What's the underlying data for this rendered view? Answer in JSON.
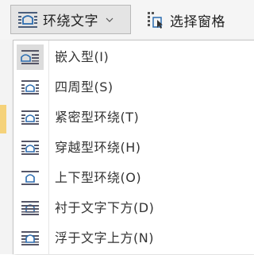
{
  "ribbon": {
    "wrap_button": {
      "label": "环绕文字",
      "icon": "wrap-text-icon"
    },
    "selection_pane": {
      "label": "选择窗格",
      "icon": "selection-pane-icon"
    }
  },
  "menu": {
    "items": [
      {
        "label": "嵌入型(I)",
        "icon": "inline-with-text-icon"
      },
      {
        "label": "四周型(S)",
        "icon": "square-wrap-icon"
      },
      {
        "label": "紧密型环绕(T)",
        "icon": "tight-wrap-icon"
      },
      {
        "label": "穿越型环绕(H)",
        "icon": "through-wrap-icon"
      },
      {
        "label": "上下型环绕(O)",
        "icon": "top-bottom-wrap-icon"
      },
      {
        "label": "衬于文字下方(D)",
        "icon": "behind-text-icon"
      },
      {
        "label": "浮于文字上方(N)",
        "icon": "in-front-of-text-icon"
      }
    ]
  },
  "colors": {
    "accent": "#2b6cb0",
    "active_bg": "#dcdcdc",
    "border": "#c6c6c6"
  }
}
